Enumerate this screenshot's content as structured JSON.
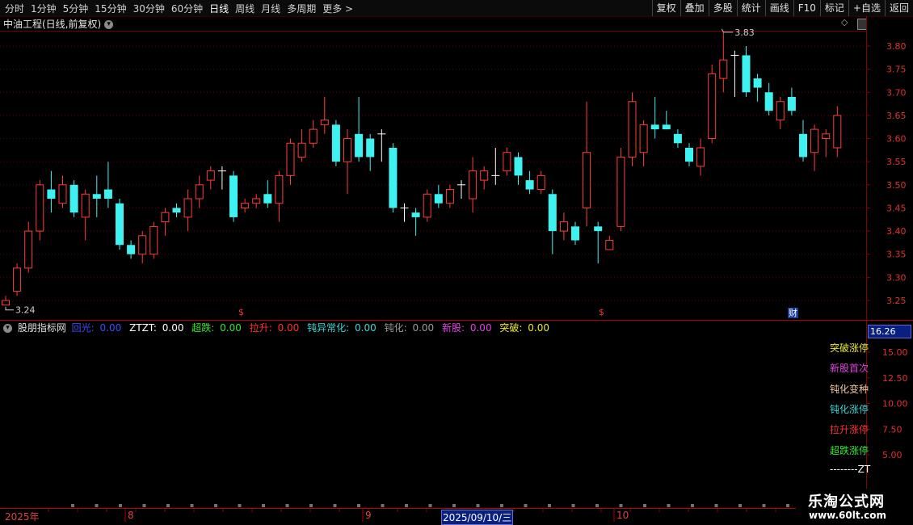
{
  "toolbar": {
    "periods": [
      "分时",
      "1分钟",
      "5分钟",
      "15分钟",
      "30分钟",
      "60分钟",
      "日线",
      "周线",
      "月线",
      "多周期",
      "更多 >"
    ],
    "active_period": "日线",
    "right_buttons": [
      "复权",
      "叠加",
      "多股",
      "统计",
      "画线",
      "F10",
      "标记",
      "+自选",
      "返回"
    ]
  },
  "title": "中油工程(日线,前复权)",
  "price_axis": {
    "ticks": [
      "3.80",
      "3.75",
      "3.70",
      "3.65",
      "3.60",
      "3.55",
      "3.50",
      "3.45",
      "3.40",
      "3.35",
      "3.30",
      "3.25"
    ]
  },
  "price_markers": {
    "high": "3.83",
    "low": "3.24"
  },
  "event_markers": {
    "s1": "$",
    "s2": "$",
    "cai": "财"
  },
  "indicator": {
    "name": "股朋指标网",
    "items": [
      {
        "label": "回光:",
        "value": "0.00",
        "color": "#3a4cff"
      },
      {
        "label": "ZTZT:",
        "value": "0.00",
        "color": "#ffffff"
      },
      {
        "label": "超跌:",
        "value": "0.00",
        "color": "#2ee82e"
      },
      {
        "label": "拉升:",
        "value": "0.00",
        "color": "#ff3030"
      },
      {
        "label": "钝异常化:",
        "value": "0.00",
        "color": "#3ad6d6"
      },
      {
        "label": "钝化:",
        "value": "0.00",
        "color": "#9a9a9a"
      },
      {
        "label": "新股:",
        "value": "0.00",
        "color": "#e040e0"
      },
      {
        "label": "突破:",
        "value": "0.00",
        "color": "#e8e830"
      }
    ],
    "current_value": "16.26",
    "axis": [
      "15.00",
      "12.50",
      "10.00",
      "7.50",
      "5.00"
    ],
    "legend": [
      {
        "text": "突破涨停",
        "color": "#e8e830"
      },
      {
        "text": "新股首次",
        "color": "#e040e0"
      },
      {
        "text": "钝化变种",
        "color": "#f0c8a0"
      },
      {
        "text": "钝化涨停",
        "color": "#3ad6d6"
      },
      {
        "text": "拉升涨停",
        "color": "#ff3030"
      },
      {
        "text": "超跌涨停",
        "color": "#2ee82e"
      },
      {
        "text": "--------ZT",
        "color": "#ffffff"
      }
    ]
  },
  "date_axis": {
    "labels": [
      "2025年",
      "8",
      "9",
      "10"
    ],
    "selected": "2025/09/10/三"
  },
  "watermark": {
    "line1": "乐淘公式网",
    "line2": "www.60lt.com"
  },
  "chart_data": {
    "type": "candlestick",
    "ylim": [
      3.22,
      3.86
    ],
    "candles": [
      {
        "o": 3.24,
        "c": 3.25,
        "h": 3.26,
        "l": 3.24
      },
      {
        "o": 3.27,
        "c": 3.32,
        "h": 3.33,
        "l": 3.26
      },
      {
        "o": 3.32,
        "c": 3.4,
        "h": 3.42,
        "l": 3.31
      },
      {
        "o": 3.4,
        "c": 3.5,
        "h": 3.51,
        "l": 3.38
      },
      {
        "o": 3.49,
        "c": 3.47,
        "h": 3.53,
        "l": 3.44
      },
      {
        "o": 3.46,
        "c": 3.5,
        "h": 3.52,
        "l": 3.45
      },
      {
        "o": 3.5,
        "c": 3.44,
        "h": 3.51,
        "l": 3.43
      },
      {
        "o": 3.43,
        "c": 3.48,
        "h": 3.49,
        "l": 3.38
      },
      {
        "o": 3.48,
        "c": 3.47,
        "h": 3.52,
        "l": 3.43
      },
      {
        "o": 3.49,
        "c": 3.47,
        "h": 3.55,
        "l": 3.45
      },
      {
        "o": 3.46,
        "c": 3.37,
        "h": 3.47,
        "l": 3.36
      },
      {
        "o": 3.37,
        "c": 3.35,
        "h": 3.38,
        "l": 3.34
      },
      {
        "o": 3.35,
        "c": 3.39,
        "h": 3.4,
        "l": 3.33
      },
      {
        "o": 3.35,
        "c": 3.41,
        "h": 3.42,
        "l": 3.34
      },
      {
        "o": 3.42,
        "c": 3.44,
        "h": 3.45,
        "l": 3.39
      },
      {
        "o": 3.45,
        "c": 3.44,
        "h": 3.46,
        "l": 3.43
      },
      {
        "o": 3.43,
        "c": 3.47,
        "h": 3.49,
        "l": 3.4
      },
      {
        "o": 3.47,
        "c": 3.5,
        "h": 3.52,
        "l": 3.45
      },
      {
        "o": 3.51,
        "c": 3.53,
        "h": 3.54,
        "l": 3.49
      },
      {
        "o": 3.53,
        "c": 3.53,
        "h": 3.54,
        "l": 3.49
      },
      {
        "o": 3.52,
        "c": 3.43,
        "h": 3.53,
        "l": 3.42
      },
      {
        "o": 3.45,
        "c": 3.46,
        "h": 3.47,
        "l": 3.44
      },
      {
        "o": 3.46,
        "c": 3.47,
        "h": 3.48,
        "l": 3.45
      },
      {
        "o": 3.48,
        "c": 3.46,
        "h": 3.51,
        "l": 3.45
      },
      {
        "o": 3.46,
        "c": 3.52,
        "h": 3.53,
        "l": 3.42
      },
      {
        "o": 3.52,
        "c": 3.59,
        "h": 3.6,
        "l": 3.5
      },
      {
        "o": 3.56,
        "c": 3.59,
        "h": 3.62,
        "l": 3.55
      },
      {
        "o": 3.59,
        "c": 3.62,
        "h": 3.64,
        "l": 3.58
      },
      {
        "o": 3.63,
        "c": 3.64,
        "h": 3.69,
        "l": 3.61
      },
      {
        "o": 3.63,
        "c": 3.55,
        "h": 3.64,
        "l": 3.54
      },
      {
        "o": 3.55,
        "c": 3.6,
        "h": 3.62,
        "l": 3.48
      },
      {
        "o": 3.61,
        "c": 3.56,
        "h": 3.69,
        "l": 3.55
      },
      {
        "o": 3.6,
        "c": 3.56,
        "h": 3.61,
        "l": 3.53
      },
      {
        "o": 3.61,
        "c": 3.61,
        "h": 3.62,
        "l": 3.55
      },
      {
        "o": 3.58,
        "c": 3.45,
        "h": 3.59,
        "l": 3.44
      },
      {
        "o": 3.45,
        "c": 3.45,
        "h": 3.46,
        "l": 3.42
      },
      {
        "o": 3.44,
        "c": 3.43,
        "h": 3.45,
        "l": 3.39
      },
      {
        "o": 3.43,
        "c": 3.48,
        "h": 3.49,
        "l": 3.42
      },
      {
        "o": 3.48,
        "c": 3.46,
        "h": 3.5,
        "l": 3.45
      },
      {
        "o": 3.46,
        "c": 3.49,
        "h": 3.5,
        "l": 3.45
      },
      {
        "o": 3.5,
        "c": 3.5,
        "h": 3.51,
        "l": 3.47
      },
      {
        "o": 3.47,
        "c": 3.53,
        "h": 3.56,
        "l": 3.44
      },
      {
        "o": 3.51,
        "c": 3.53,
        "h": 3.54,
        "l": 3.49
      },
      {
        "o": 3.52,
        "c": 3.52,
        "h": 3.58,
        "l": 3.5
      },
      {
        "o": 3.53,
        "c": 3.57,
        "h": 3.58,
        "l": 3.52
      },
      {
        "o": 3.56,
        "c": 3.52,
        "h": 3.57,
        "l": 3.5
      },
      {
        "o": 3.51,
        "c": 3.49,
        "h": 3.53,
        "l": 3.48
      },
      {
        "o": 3.49,
        "c": 3.52,
        "h": 3.53,
        "l": 3.48
      },
      {
        "o": 3.48,
        "c": 3.4,
        "h": 3.49,
        "l": 3.35
      },
      {
        "o": 3.4,
        "c": 3.42,
        "h": 3.44,
        "l": 3.38
      },
      {
        "o": 3.41,
        "c": 3.38,
        "h": 3.42,
        "l": 3.37
      },
      {
        "o": 3.45,
        "c": 3.57,
        "h": 3.68,
        "l": 3.41
      },
      {
        "o": 3.41,
        "c": 3.4,
        "h": 3.42,
        "l": 3.33
      },
      {
        "o": 3.36,
        "c": 3.38,
        "h": 3.39,
        "l": 3.36
      },
      {
        "o": 3.41,
        "c": 3.56,
        "h": 3.58,
        "l": 3.4
      },
      {
        "o": 3.56,
        "c": 3.68,
        "h": 3.7,
        "l": 3.54
      },
      {
        "o": 3.57,
        "c": 3.63,
        "h": 3.64,
        "l": 3.54
      },
      {
        "o": 3.63,
        "c": 3.62,
        "h": 3.69,
        "l": 3.6
      },
      {
        "o": 3.63,
        "c": 3.62,
        "h": 3.66,
        "l": 3.62
      },
      {
        "o": 3.61,
        "c": 3.59,
        "h": 3.62,
        "l": 3.58
      },
      {
        "o": 3.58,
        "c": 3.55,
        "h": 3.59,
        "l": 3.54
      },
      {
        "o": 3.54,
        "c": 3.58,
        "h": 3.6,
        "l": 3.52
      },
      {
        "o": 3.6,
        "c": 3.74,
        "h": 3.76,
        "l": 3.59
      },
      {
        "o": 3.73,
        "c": 3.77,
        "h": 3.83,
        "l": 3.7
      },
      {
        "o": 3.78,
        "c": 3.78,
        "h": 3.79,
        "l": 3.69
      },
      {
        "o": 3.78,
        "c": 3.7,
        "h": 3.8,
        "l": 3.69
      },
      {
        "o": 3.73,
        "c": 3.71,
        "h": 3.74,
        "l": 3.68
      },
      {
        "o": 3.7,
        "c": 3.66,
        "h": 3.72,
        "l": 3.65
      },
      {
        "o": 3.64,
        "c": 3.68,
        "h": 3.69,
        "l": 3.62
      },
      {
        "o": 3.69,
        "c": 3.66,
        "h": 3.71,
        "l": 3.65
      },
      {
        "o": 3.61,
        "c": 3.56,
        "h": 3.64,
        "l": 3.55
      },
      {
        "o": 3.57,
        "c": 3.62,
        "h": 3.63,
        "l": 3.53
      },
      {
        "o": 3.6,
        "c": 3.61,
        "h": 3.62,
        "l": 3.56
      },
      {
        "o": 3.58,
        "c": 3.65,
        "h": 3.67,
        "l": 3.56
      }
    ]
  }
}
